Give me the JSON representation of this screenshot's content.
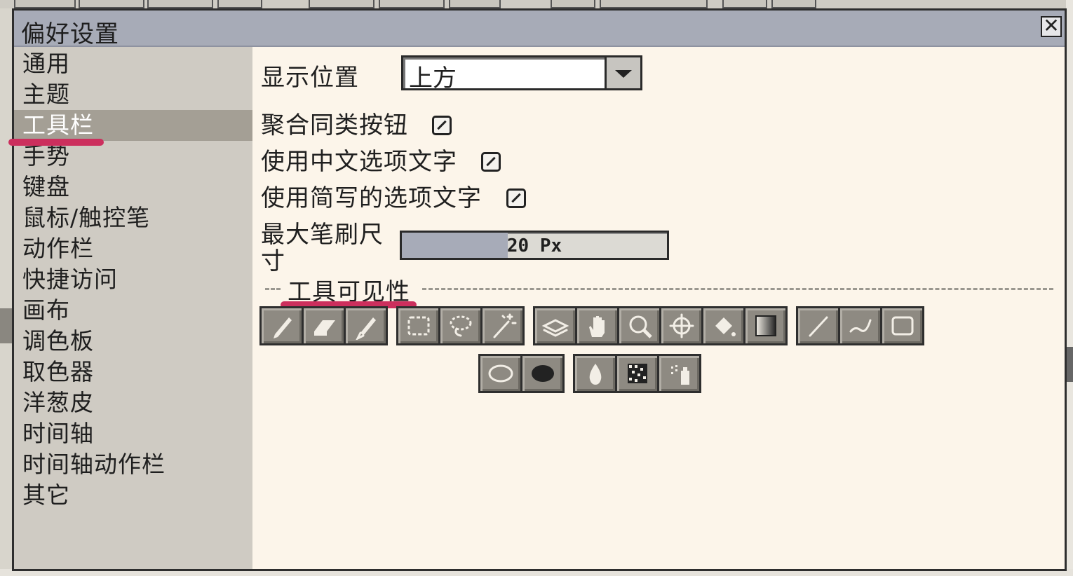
{
  "window": {
    "title": "偏好设置",
    "close_glyph": "✕"
  },
  "sidebar": {
    "items": [
      {
        "label": "通用",
        "active": false
      },
      {
        "label": "主题",
        "active": false
      },
      {
        "label": "工具栏",
        "active": true
      },
      {
        "label": "手势",
        "active": false
      },
      {
        "label": "键盘",
        "active": false
      },
      {
        "label": "鼠标/触控笔",
        "active": false
      },
      {
        "label": "动作栏",
        "active": false
      },
      {
        "label": "快捷访问",
        "active": false
      },
      {
        "label": "画布",
        "active": false
      },
      {
        "label": "调色板",
        "active": false
      },
      {
        "label": "取色器",
        "active": false
      },
      {
        "label": "洋葱皮",
        "active": false
      },
      {
        "label": "时间轴",
        "active": false
      },
      {
        "label": "时间轴动作栏",
        "active": false
      },
      {
        "label": "其它",
        "active": false
      }
    ]
  },
  "settings": {
    "display_position_label": "显示位置",
    "display_position_value": "上方",
    "group_buttons_label": "聚合同类按钮",
    "group_buttons_checked": true,
    "chinese_text_label": "使用中文选项文字",
    "chinese_text_checked": true,
    "abbrev_text_label": "使用简写的选项文字",
    "abbrev_text_checked": true,
    "max_brush_label_line1": "最大笔刷尺",
    "max_brush_label_line2": "寸",
    "max_brush_value": "20 Px",
    "max_brush_fill_fraction": 0.4
  },
  "tool_visibility": {
    "section_title": "工具可见性",
    "row1": [
      [
        "pencil-icon",
        "eraser-icon",
        "pen-icon"
      ],
      [
        "rect-select-icon",
        "lasso-select-icon",
        "magic-wand-icon"
      ],
      [
        "layers-icon",
        "hand-icon",
        "zoom-icon",
        "move-icon",
        "fill-bucket-icon",
        "gradient-icon"
      ],
      [
        "line-icon",
        "curve-icon",
        "rectangle-icon"
      ]
    ],
    "row2": [
      [
        "ellipse-icon",
        "blob-icon"
      ],
      [
        "drop-icon",
        "dither-icon",
        "spray-icon"
      ]
    ]
  },
  "colors": {
    "titlebar": "#a7abb7",
    "sidebar": "#cfcbc3",
    "sidebar_active": "#a49f95",
    "content_bg": "#fcf5ea",
    "highlight_underline": "#cc2f5d"
  }
}
